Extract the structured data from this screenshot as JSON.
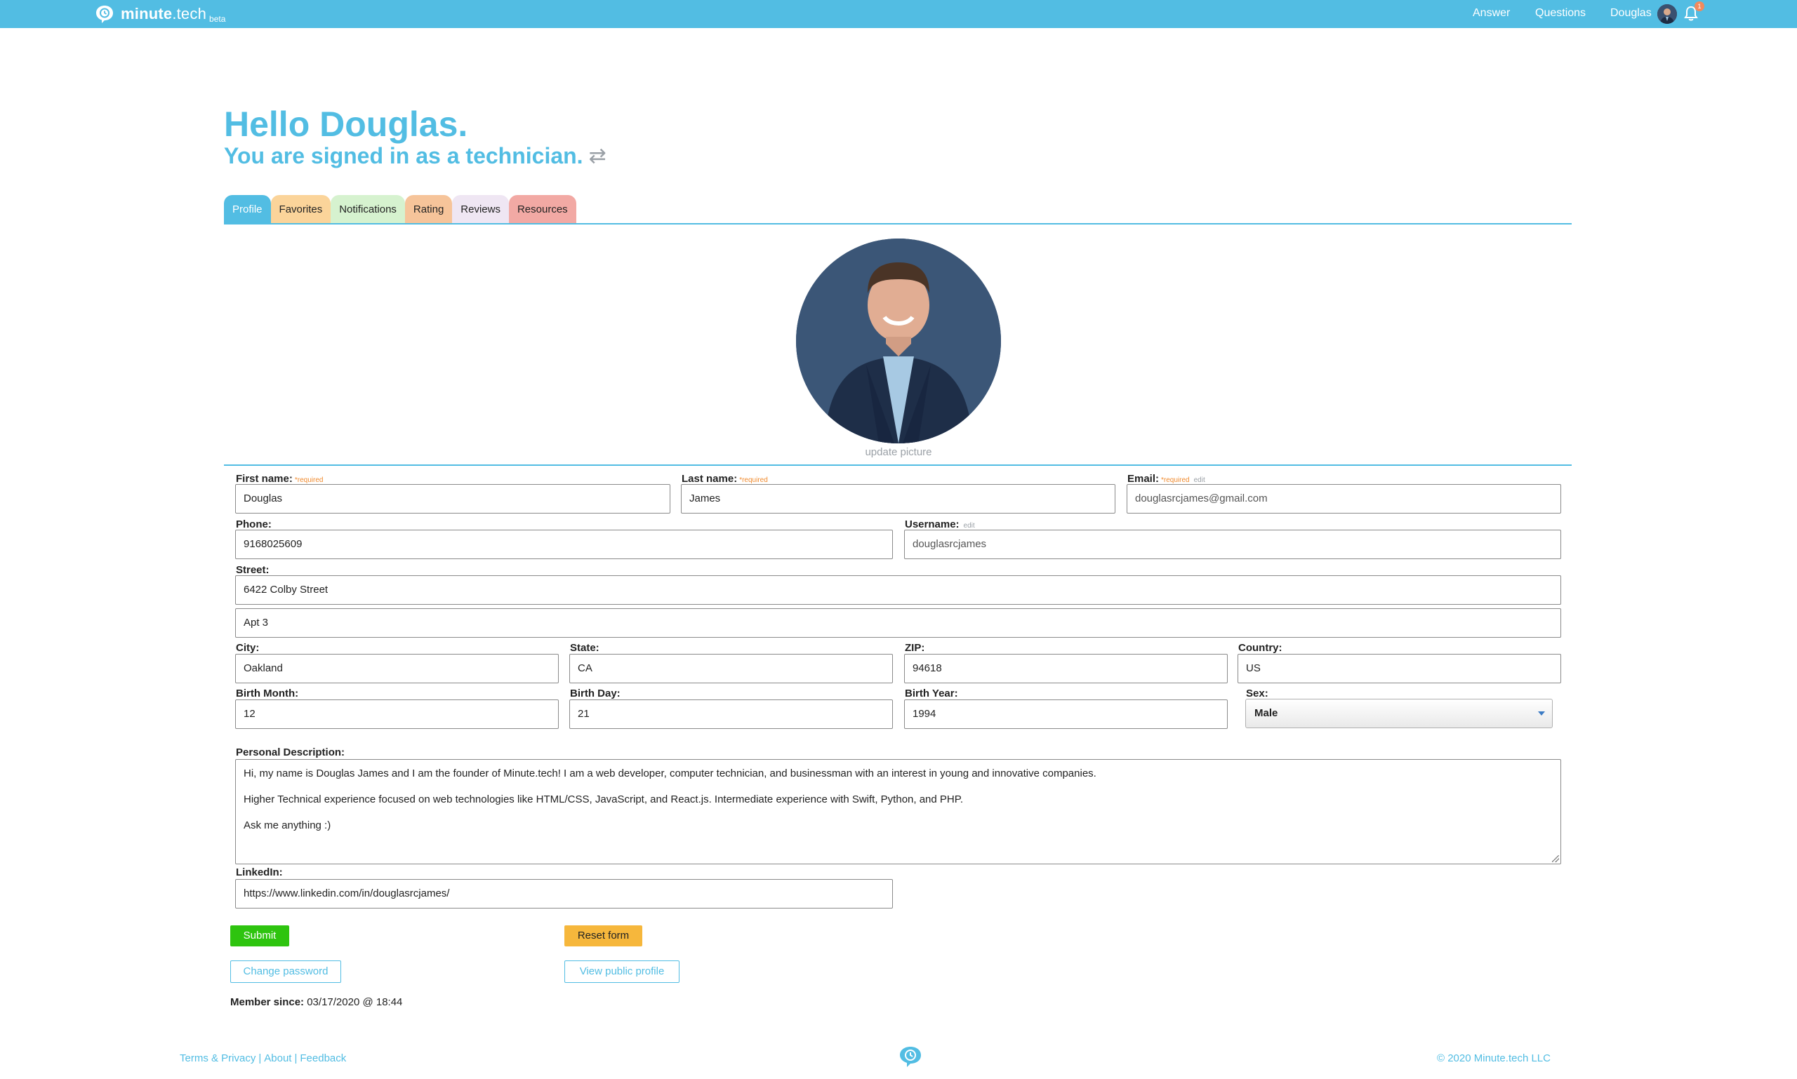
{
  "nav": {
    "brand_bold": "minute",
    "brand_rest": ".tech",
    "brand_beta": "beta",
    "answer": "Answer",
    "questions": "Questions",
    "user": "Douglas",
    "notification_count": "1"
  },
  "header": {
    "hello": "Hello Douglas.",
    "signed_in": "You are signed in as a technician.",
    "swap_icon": "⇄"
  },
  "tabs": [
    {
      "label": "Profile",
      "color": "#52bde3"
    },
    {
      "label": "Favorites",
      "color": "#fbd49a"
    },
    {
      "label": "Notifications",
      "color": "#d6f2cf"
    },
    {
      "label": "Rating",
      "color": "#f6c49a"
    },
    {
      "label": "Reviews",
      "color": "#efe6f3"
    },
    {
      "label": "Resources",
      "color": "#f2a9a4"
    }
  ],
  "picture": {
    "update_label": "update picture"
  },
  "form": {
    "required_text": "*required",
    "edit_text": "edit",
    "first_name": {
      "label": "First name:",
      "value": "Douglas"
    },
    "last_name": {
      "label": "Last name:",
      "value": "James"
    },
    "email": {
      "label": "Email:",
      "value": "douglasrcjames@gmail.com"
    },
    "phone": {
      "label": "Phone:",
      "value": "9168025609"
    },
    "username": {
      "label": "Username:",
      "value": "douglasrcjames"
    },
    "street": {
      "label": "Street:",
      "value": "6422 Colby Street",
      "value2": "Apt 3"
    },
    "city": {
      "label": "City:",
      "value": "Oakland"
    },
    "state": {
      "label": "State:",
      "value": "CA"
    },
    "zip": {
      "label": "ZIP:",
      "value": "94618"
    },
    "country": {
      "label": "Country:",
      "value": "US"
    },
    "birth_month": {
      "label": "Birth Month:",
      "value": "12"
    },
    "birth_day": {
      "label": "Birth Day:",
      "value": "21"
    },
    "birth_year": {
      "label": "Birth Year:",
      "value": "1994"
    },
    "sex": {
      "label": "Sex:",
      "value": "Male"
    },
    "description": {
      "label": "Personal Description:",
      "lines": [
        "Hi, my name is Douglas James and I am the founder of Minute.tech! I am a web developer, computer technician, and businessman with an interest in young and innovative companies.",
        "Higher Technical experience focused on web technologies like HTML/CSS, JavaScript, and React.js. Intermediate experience with Swift, Python, and PHP.",
        "Ask me anything :)"
      ]
    },
    "linkedin": {
      "label": "LinkedIn:",
      "value": "https://www.linkedin.com/in/douglasrcjames/"
    }
  },
  "actions": {
    "submit": "Submit",
    "reset": "Reset form",
    "change_password": "Change password",
    "view_public": "View public profile"
  },
  "member": {
    "label": "Member since:",
    "value": "03/17/2020 @ 18:44"
  },
  "footer": {
    "terms": "Terms & Privacy",
    "about": "About",
    "feedback": "Feedback",
    "separator": "|",
    "copyright": "© 2020 Minute.tech LLC"
  },
  "colors": {
    "brand": "#52bde3",
    "submit": "#2ec40f",
    "reset": "#f6b73c",
    "required": "#f08a2d"
  }
}
